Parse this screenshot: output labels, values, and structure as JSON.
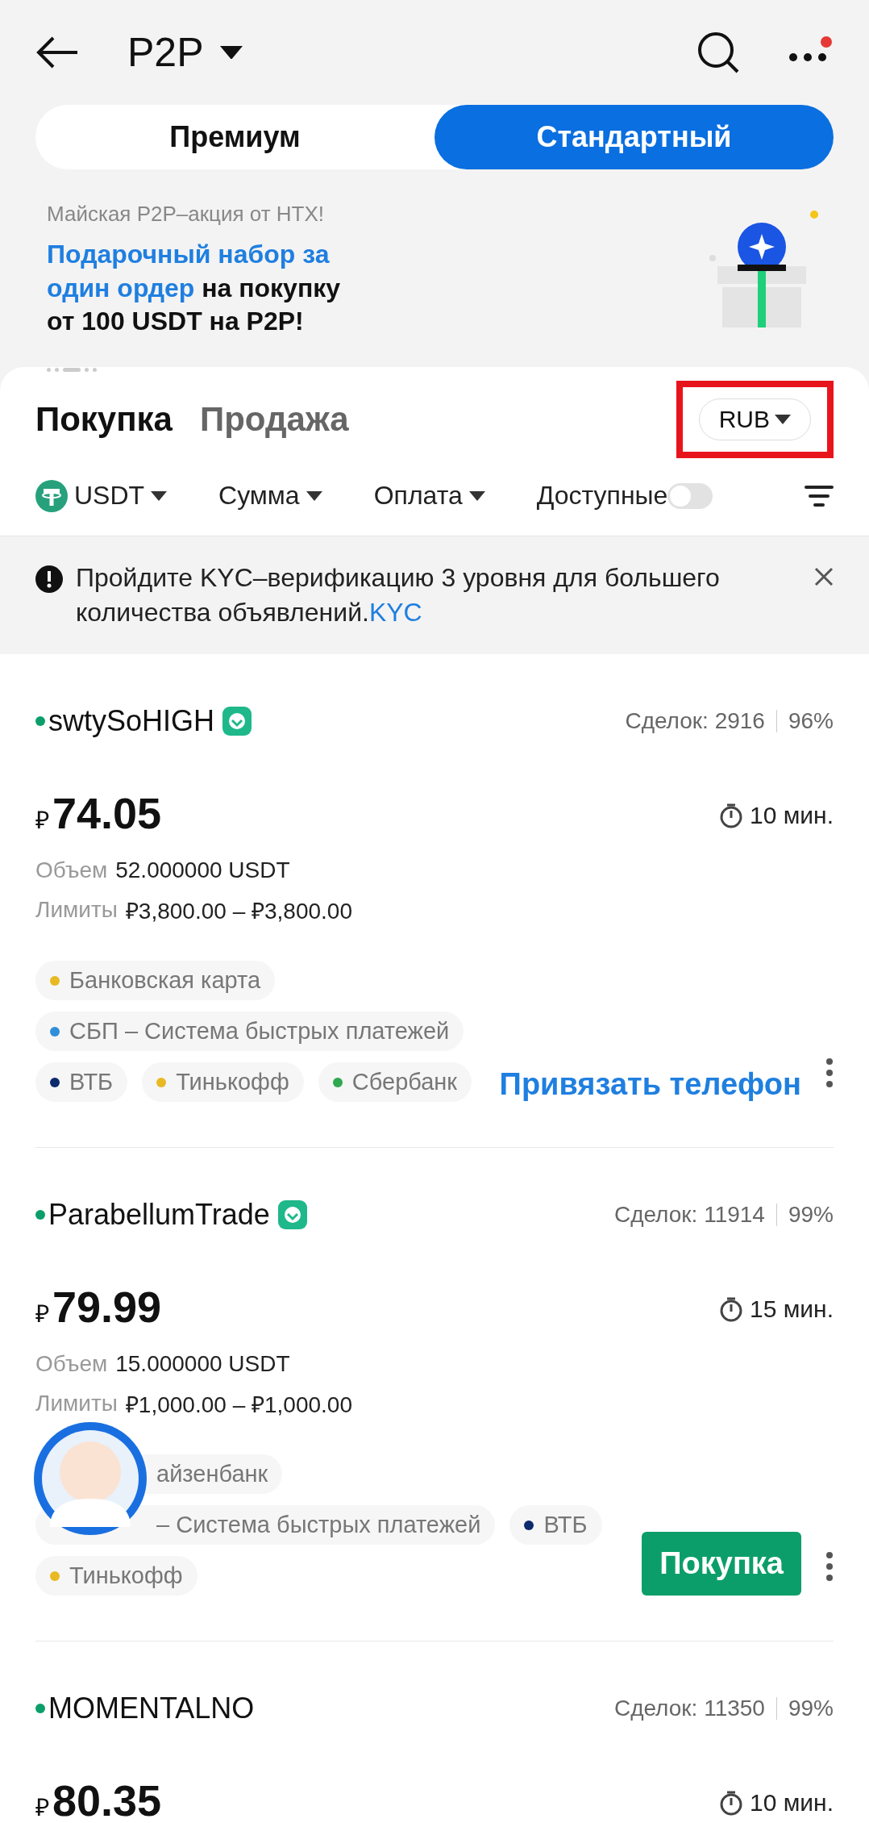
{
  "header": {
    "title": "P2P",
    "notification_dot": true
  },
  "mode_tabs": [
    {
      "label": "Премиум",
      "selected": false
    },
    {
      "label": "Стандартный",
      "selected": true
    }
  ],
  "banner": {
    "subtitle": "Майская P2P–акция от HTX!",
    "headline": "**Подарочный набор за один ордер** на покупку от 100 USDT на P2P!",
    "page_dots": [
      {
        "selected": false
      },
      {
        "selected": false
      },
      {
        "selected": true
      },
      {
        "selected": false
      },
      {
        "selected": false
      }
    ]
  },
  "side_tabs": [
    {
      "label": "Покупка",
      "selected": true
    },
    {
      "label": "Продажа",
      "selected": false
    }
  ],
  "currency": {
    "label": "RUB",
    "highlighted": true
  },
  "filters": [
    {
      "label": "USDT",
      "kind": "coin"
    },
    {
      "label": "Сумма",
      "kind": "dropdown"
    },
    {
      "label": "Оплата",
      "kind": "dropdown"
    },
    {
      "label": "Доступные",
      "kind": "toggle",
      "on": false
    }
  ],
  "notice": {
    "text": "Пройдите KYC–верификацию 3 уровня для большего количества объявлений.",
    "link": "KYC"
  },
  "offers": [
    {
      "name": "swtySoHIGH",
      "verified": true,
      "deals": "Сделок: 2916",
      "rate": "96%",
      "currency_sign": "₽",
      "price": "74.05",
      "time": "10 мин.",
      "volume_label": "Объем",
      "volume": "52.000000 USDT",
      "limits_label": "Лимиты",
      "limits": "₽3,800.00 – ₽3,800.00",
      "tags": [
        {
          "label": "Банковская карта",
          "color": "#e8b923"
        },
        {
          "label": "СБП – Система быстрых платежей",
          "color": "#2f8fd8"
        },
        {
          "label": "ВТБ",
          "color": "#0d2a6b"
        },
        {
          "label": "Тинькофф",
          "color": "#e8b923"
        },
        {
          "label": "Сбербанк",
          "color": "#2fa84f"
        }
      ],
      "action": {
        "kind": "link",
        "label": "Привязать телефон"
      }
    },
    {
      "name": "ParabellumTrade",
      "verified": true,
      "deals": "Сделок: 11914",
      "rate": "99%",
      "currency_sign": "₽",
      "price": "79.99",
      "time": "15 мин.",
      "volume_label": "Объем",
      "volume": "15.000000 USDT",
      "limits_label": "Лимиты",
      "limits": "₽1,000.00 – ₽1,000.00",
      "tags": [
        {
          "label": "айзенбанк",
          "covered": true
        },
        {
          "label": "– Система быстрых платежей",
          "covered": true
        },
        {
          "label": "ВТБ",
          "color": "#0d2a6b"
        },
        {
          "label": "Тинькофф",
          "color": "#e8b923"
        }
      ],
      "action": {
        "kind": "button",
        "label": "Покупка"
      }
    },
    {
      "name": "MOMENTALNO",
      "verified": false,
      "deals": "Сделок: 11350",
      "rate": "99%",
      "currency_sign": "₽",
      "price": "80.35",
      "time": "10 мин."
    }
  ]
}
